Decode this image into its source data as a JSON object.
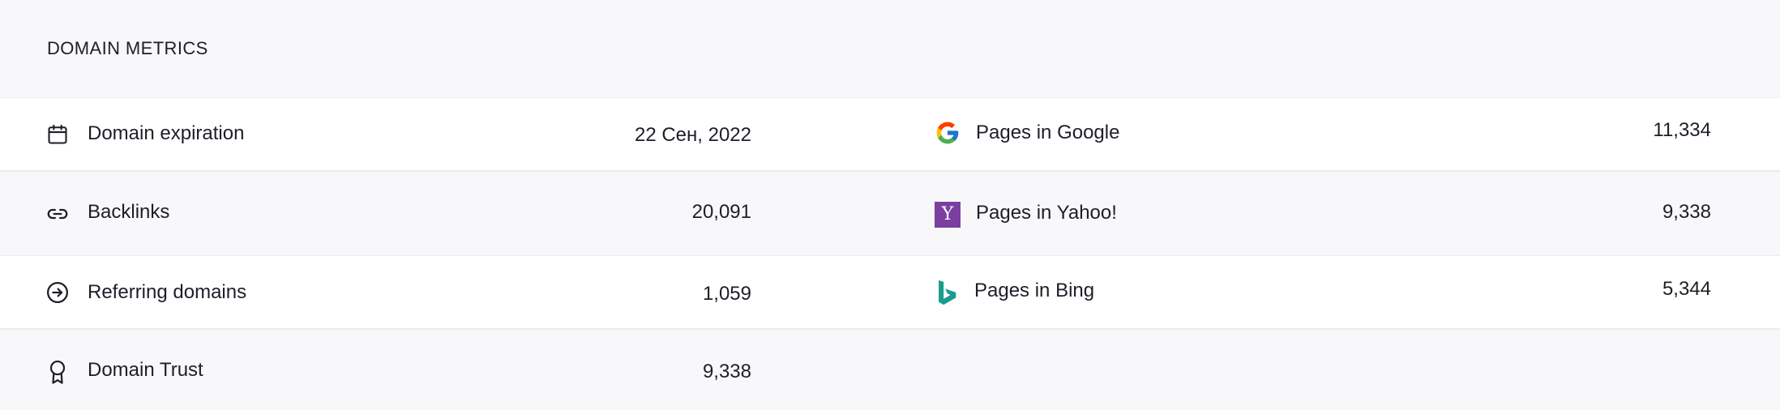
{
  "header": {
    "title": "DOMAIN METRICS"
  },
  "metrics_left": [
    {
      "icon": "calendar-icon",
      "label": "Domain expiration",
      "value": "22 Сен, 2022"
    },
    {
      "icon": "link-icon",
      "label": "Backlinks",
      "value": "20,091"
    },
    {
      "icon": "arrow-circle-icon",
      "label": "Referring domains",
      "value": "1,059"
    },
    {
      "icon": "award-icon",
      "label": "Domain Trust",
      "value": "9,338"
    }
  ],
  "metrics_right": [
    {
      "icon": "google-icon",
      "label": "Pages in Google",
      "value": "11,334"
    },
    {
      "icon": "yahoo-icon",
      "label": "Pages in Yahoo!",
      "value": "9,338",
      "icon_letter": "Y"
    },
    {
      "icon": "bing-icon",
      "label": "Pages in Bing",
      "value": "5,344"
    }
  ],
  "colors": {
    "yahoo": "#7b3fa0",
    "bing": "#1a9c8c",
    "google_blue": "#4285F4",
    "google_red": "#EA4335",
    "google_yellow": "#FBBC05",
    "google_green": "#34A853"
  }
}
